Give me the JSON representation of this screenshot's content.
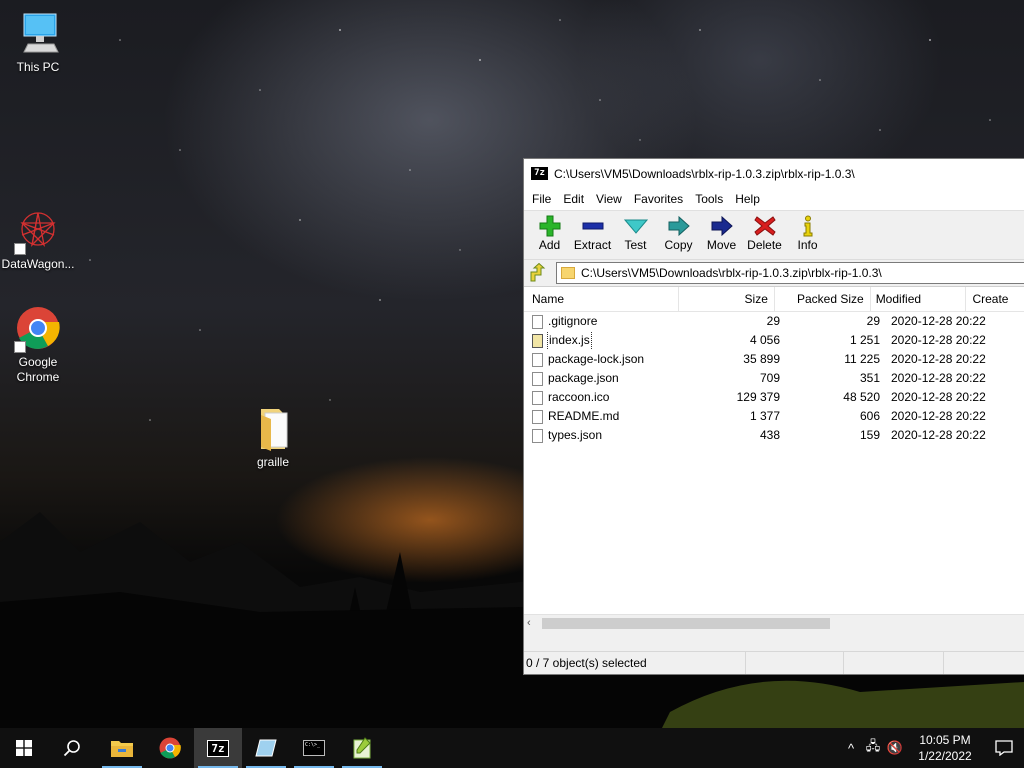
{
  "desktop": {
    "icons": [
      {
        "label": "This PC"
      },
      {
        "label": "DataWagon..."
      },
      {
        "label": "Google Chrome"
      },
      {
        "label": "graille"
      }
    ]
  },
  "window": {
    "title": "C:\\Users\\VM5\\Downloads\\rblx-rip-1.0.3.zip\\rblx-rip-1.0.3\\",
    "app_badge": "7z",
    "menu": [
      "File",
      "Edit",
      "View",
      "Favorites",
      "Tools",
      "Help"
    ],
    "toolbar": {
      "add": "Add",
      "extract": "Extract",
      "test": "Test",
      "copy": "Copy",
      "move": "Move",
      "delete": "Delete",
      "info": "Info"
    },
    "address": "C:\\Users\\VM5\\Downloads\\rblx-rip-1.0.3.zip\\rblx-rip-1.0.3\\",
    "columns": {
      "name": "Name",
      "size": "Size",
      "packed": "Packed Size",
      "modified": "Modified",
      "created": "Create"
    },
    "files": [
      {
        "name": ".gitignore",
        "size": "29",
        "packed": "29",
        "modified": "2020-12-28 20:22"
      },
      {
        "name": "index.js",
        "size": "4 056",
        "packed": "1 251",
        "modified": "2020-12-28 20:22"
      },
      {
        "name": "package-lock.json",
        "size": "35 899",
        "packed": "11 225",
        "modified": "2020-12-28 20:22"
      },
      {
        "name": "package.json",
        "size": "709",
        "packed": "351",
        "modified": "2020-12-28 20:22"
      },
      {
        "name": "raccoon.ico",
        "size": "129 379",
        "packed": "48 520",
        "modified": "2020-12-28 20:22"
      },
      {
        "name": "README.md",
        "size": "1 377",
        "packed": "606",
        "modified": "2020-12-28 20:22"
      },
      {
        "name": "types.json",
        "size": "438",
        "packed": "159",
        "modified": "2020-12-28 20:22"
      }
    ],
    "status": "0 / 7 object(s) selected"
  },
  "taskbar": {
    "clock_time": "10:05 PM",
    "clock_date": "1/22/2022",
    "cmd_glyph": "C:\\>_",
    "accent": "#76b9ed"
  }
}
